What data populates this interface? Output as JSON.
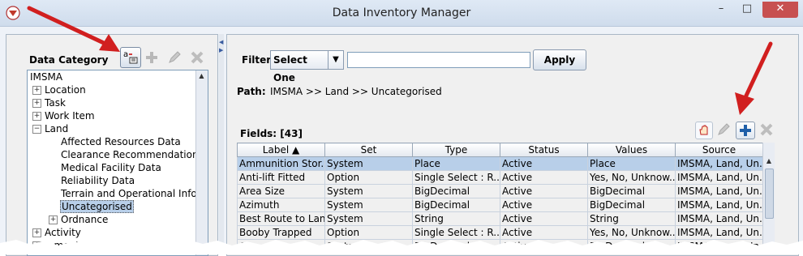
{
  "window": {
    "title": "Data Inventory Manager",
    "controls": [
      "–",
      "□",
      "✕"
    ]
  },
  "left": {
    "header": "Data Category",
    "toolbar_icons": [
      "add-category-icon",
      "plus-icon",
      "pencil-icon",
      "delete-icon"
    ],
    "tree": [
      {
        "label": "IMSMA",
        "level": 0,
        "toggle": ""
      },
      {
        "label": "Location",
        "level": 1,
        "toggle": "+"
      },
      {
        "label": "Task",
        "level": 1,
        "toggle": "+"
      },
      {
        "label": "Work Item",
        "level": 1,
        "toggle": "+"
      },
      {
        "label": "Land",
        "level": 1,
        "toggle": "−"
      },
      {
        "label": "Affected Resources Data",
        "level": 2,
        "toggle": ""
      },
      {
        "label": "Clearance Recommendation D",
        "level": 2,
        "toggle": ""
      },
      {
        "label": "Medical Facility Data",
        "level": 2,
        "toggle": ""
      },
      {
        "label": "Reliability Data",
        "level": 2,
        "toggle": ""
      },
      {
        "label": "Terrain and Operational Inform",
        "level": 2,
        "toggle": ""
      },
      {
        "label": "Uncategorised",
        "level": 2,
        "toggle": "",
        "selected": true
      },
      {
        "label": "Ordnance",
        "level": 2,
        "toggle": "+"
      },
      {
        "label": "Activity",
        "level": 1,
        "toggle": "+"
      },
      {
        "label": "...ment",
        "level": 1,
        "toggle": "+"
      }
    ]
  },
  "right": {
    "filter_label": "Filter:",
    "filter_select": "Select One",
    "filter_value": "",
    "apply_label": "Apply",
    "path_label": "Path:",
    "path_value": "IMSMA >> Land >> Uncategorised",
    "fields_label": "Fields: [43]",
    "toolbar_icons": [
      "hand-icon",
      "pencil-icon",
      "plus-icon",
      "delete-icon"
    ],
    "columns": [
      "Label ▲",
      "Set",
      "Type",
      "Status",
      "Values",
      "Source"
    ],
    "rows": [
      [
        "Ammunition Stor...",
        "System",
        "Place",
        "Active",
        "Place",
        "IMSMA, Land, Un..."
      ],
      [
        "Anti-lift Fitted",
        "Option",
        "Single Select : R...",
        "Active",
        "Yes, No, Unknow...",
        "IMSMA, Land, Un..."
      ],
      [
        "Area Size",
        "System",
        "BigDecimal",
        "Active",
        "BigDecimal",
        "IMSMA, Land, Un..."
      ],
      [
        "Azimuth",
        "System",
        "BigDecimal",
        "Active",
        "BigDecimal",
        "IMSMA, Land, Un..."
      ],
      [
        "Best Route to Land",
        "System",
        "String",
        "Active",
        "String",
        "IMSMA, Land, Un..."
      ],
      [
        "Booby Trapped",
        "Option",
        "Single Select : R...",
        "Active",
        "Yes, No, Unknow...",
        "IMSMA, Land, Un..."
      ],
      [
        "Co...",
        "System",
        "BigDecimal",
        "Active",
        "BigDecimal",
        "IMSMA, Land, Un..."
      ]
    ]
  },
  "colors": {
    "selection": "#b8cfe9",
    "arrow": "#d11f1f"
  }
}
